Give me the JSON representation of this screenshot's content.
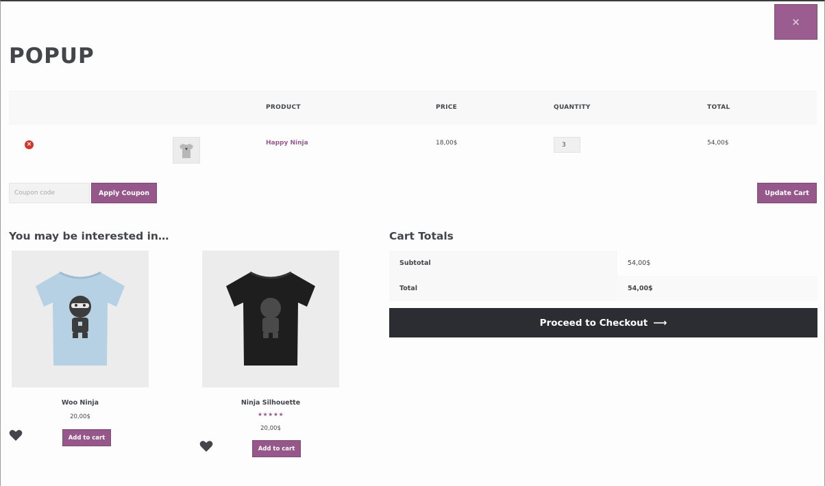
{
  "popup": {
    "title": "POPUP",
    "close_glyph": "×"
  },
  "cart": {
    "columns": [
      "",
      "",
      "PRODUCT",
      "PRICE",
      "QUANTITY",
      "TOTAL"
    ],
    "items": [
      {
        "remove_glyph": "×",
        "thumbnail": "grey-ninja-tshirt",
        "name": "Happy Ninja",
        "price": "18,00$",
        "quantity": "3",
        "total": "54,00$"
      }
    ],
    "coupon_placeholder": "Coupon code",
    "apply_coupon_label": "Apply Coupon",
    "update_cart_label": "Update Cart"
  },
  "related": {
    "heading": "You may be interested in…",
    "products": [
      {
        "name": "Woo Ninja",
        "price": "20,00$",
        "rating": null,
        "image": "light-blue-ninja-tshirt",
        "add_label": "Add to cart"
      },
      {
        "name": "Ninja Silhouette",
        "price": "20,00$",
        "rating": 5,
        "image": "black-ninja-tshirt",
        "add_label": "Add to cart"
      }
    ]
  },
  "totals": {
    "heading": "Cart Totals",
    "subtotal_label": "Subtotal",
    "subtotal_value": "54,00$",
    "total_label": "Total",
    "total_value": "54,00$",
    "checkout_label": "Proceed to Checkout",
    "checkout_arrow": "⟶"
  },
  "colors": {
    "accent": "#96588a",
    "dark_button": "#2c2d33",
    "remove_red": "#d3342b"
  }
}
